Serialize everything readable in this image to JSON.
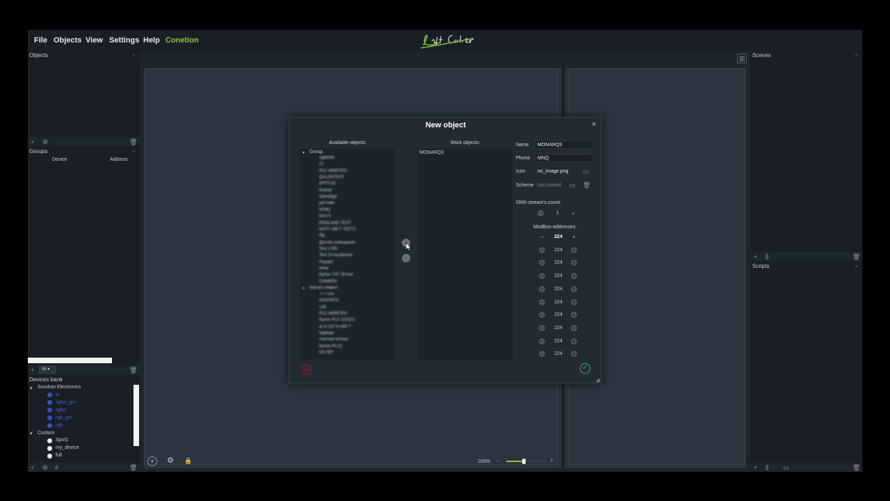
{
  "menu": {
    "file": "File",
    "objects": "Objects",
    "view": "View",
    "settings": "Settings",
    "help": "Help",
    "connection": "Conetion"
  },
  "colors": {
    "accent_green": "#8cc63f",
    "brand_green": "#7dbf3a",
    "cancel_red": "#a01f2c",
    "ok_green": "#3db36a",
    "device_blue": "#4a5fd0"
  },
  "left_panel": {
    "objects_title": "Objects",
    "groups_title": "Groups",
    "groups_columns": [
      "Device",
      "Address"
    ],
    "filter_value": "All",
    "devices_bank_title": "Devices bank",
    "devices_tree": {
      "vendor": "Sundrax Electronics",
      "vendor_items": [
        "w",
        "rgbw_gm",
        "rgbw",
        "rgb_gm",
        "rgb"
      ],
      "custom_group": "Custom",
      "custom_items": [
        "Spot1",
        "my_device",
        "full"
      ]
    }
  },
  "right_panel": {
    "scenes_title": "Scenes",
    "scripts_title": "Scripts"
  },
  "bottom_bar": {
    "zoom_label": "100%",
    "zoom_level_fraction": 0.45
  },
  "dialog": {
    "title": "New object",
    "available_title": "Available objects:",
    "work_title": "Work objects:",
    "available_group_1": "Group",
    "available_items_1": [
      "ngb8nfb",
      "CI",
      "PLC 4WRITES",
      "QALONTEST",
      "БРТП-ID",
      "Rubrid",
      "Оренбург",
      "датчики",
      "НПФ2",
      "farm 5",
      "ENGLAND TEST",
      "БКТП 186 Т ТЕСТ1",
      "РД",
      "Датчик освещения",
      "Test 2 RD",
      "Test 10 kazahstan",
      "Радар1",
      "temp",
      "Кулон ТАТ 29 test",
      "CAMERA"
    ],
    "available_group_2": "Магнит Инвест",
    "available_items_2": [
      "TTT-EN",
      "GAKARTA",
      "126",
      "PLC 4WRITES",
      "Кулон PLC 222222",
      "кк 3-120 3+980 Т",
      "Кдмера",
      "счетчик потока",
      "Кулон PLC2",
      "OCTEP"
    ],
    "work_items": [
      "MONARQ3"
    ],
    "name_label": "Name",
    "name_value": "MONARQ3",
    "phone_label": "Phone",
    "phone_value": "MNQ",
    "icon_label": "Icon",
    "icon_value": "no_image.png",
    "scheme_label": "Scheme",
    "scheme_placeholder": "Not loaded",
    "dmx_label": "DMX-stream's count:",
    "dmx_value": "1",
    "modbus_label": "ModBus-addresses:",
    "modbus_values": [
      "224",
      "224",
      "224",
      "224",
      "224",
      "224",
      "224",
      "224",
      "224",
      "224"
    ]
  }
}
